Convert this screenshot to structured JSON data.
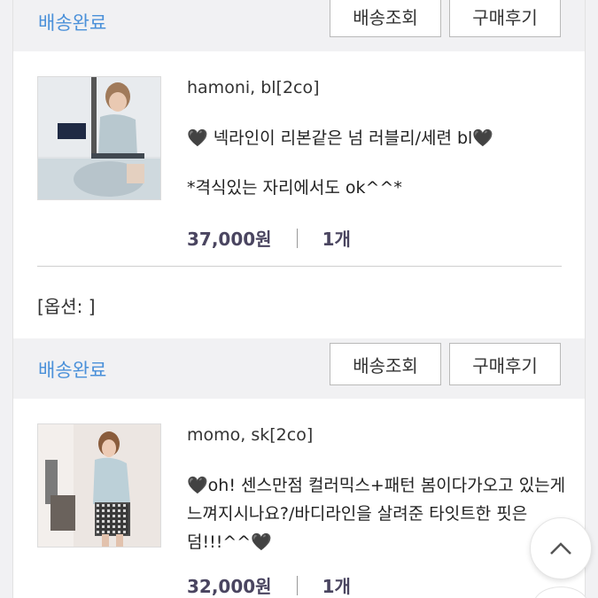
{
  "orders": [
    {
      "status": "배송완료",
      "track_label": "배송조회",
      "review_label": "구매후기",
      "product_name": "hamoni, bl[2co]",
      "desc_line1": "🖤 넥라인이 리본같은 넘 러블리/세련 bl🖤",
      "desc_line2": "*격식있는 자리에서도 ok^^*",
      "price": "37,000원",
      "qty": "1개",
      "option": "[옵션: ]"
    },
    {
      "status": "배송완료",
      "track_label": "배송조회",
      "review_label": "구매후기",
      "product_name": "momo, sk[2co]",
      "desc_line1": "🖤oh! 센스만점 컬러믹스+패턴 봄이다가오고 있는게 느껴지시나요?/바디라인을 살려준 타잇트한 핏은 덤!!!^^🖤",
      "price": "32,000원",
      "qty": "1개"
    }
  ],
  "icons": {
    "scroll_top": "chevron-up-icon"
  }
}
